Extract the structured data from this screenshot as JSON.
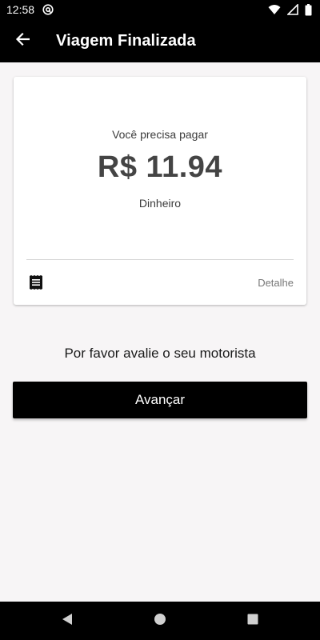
{
  "status_bar": {
    "time": "12:58"
  },
  "app_bar": {
    "title": "Viagem Finalizada"
  },
  "payment": {
    "label": "Você precisa pagar",
    "amount": "R$ 11.94",
    "method": "Dinheiro",
    "detail_label": "Detalhe"
  },
  "rating": {
    "prompt": "Por favor avalie o seu motorista"
  },
  "actions": {
    "advance_label": "Avançar"
  },
  "icons": {
    "back": "arrow-back-icon",
    "receipt": "receipt-icon",
    "wifi": "wifi-icon",
    "signal": "signal-icon",
    "battery": "battery-icon",
    "notification": "at-sign-icon"
  }
}
